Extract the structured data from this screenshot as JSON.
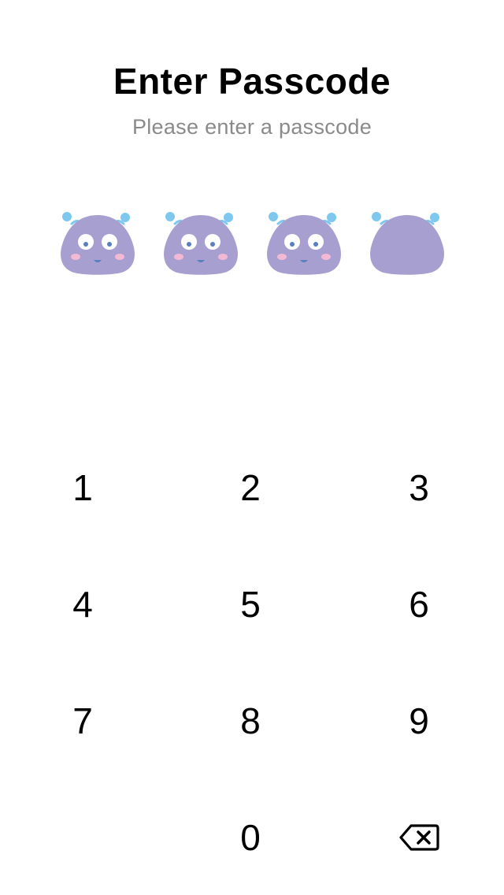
{
  "header": {
    "title": "Enter Passcode",
    "subtitle": "Please enter a passcode"
  },
  "passcode": {
    "length": 4,
    "entered": 3,
    "indicator_icon": "creature-face-icon",
    "colors": {
      "body": "#a69fcf",
      "antenna": "#7ec8ef",
      "eye": "#ffffff",
      "pupil": "#5a7fbf",
      "blush": "#f2b8d4",
      "mouth": "#5a7fbf"
    }
  },
  "keypad": {
    "keys": [
      "1",
      "2",
      "3",
      "4",
      "5",
      "6",
      "7",
      "8",
      "9",
      "0"
    ],
    "delete_icon": "backspace-icon"
  }
}
